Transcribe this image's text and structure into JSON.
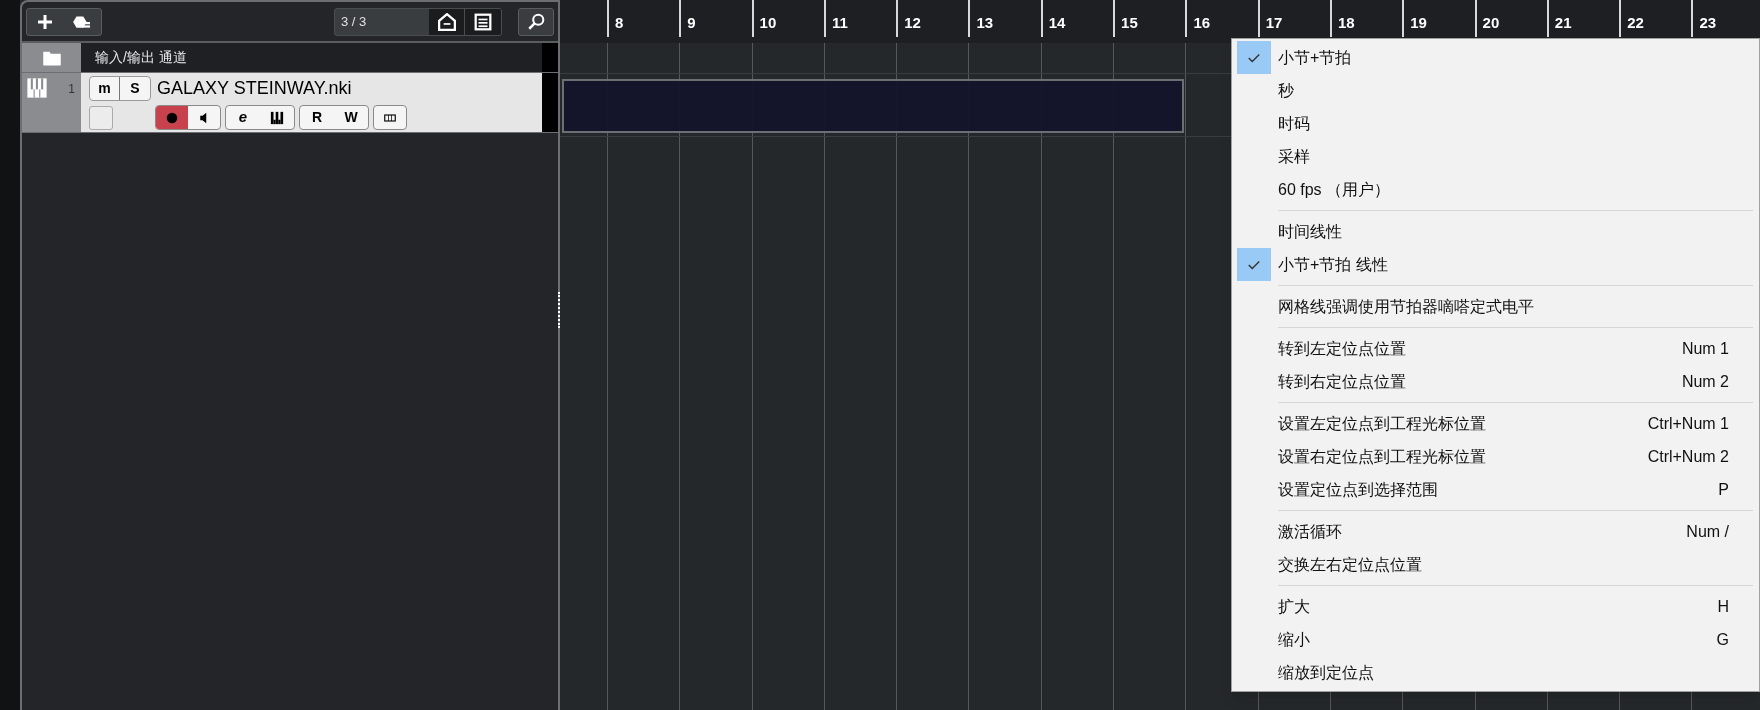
{
  "toolbar": {
    "track_counter": "3 / 3"
  },
  "track_list": {
    "header": {
      "title": "输入/输出 通道"
    },
    "tracks": [
      {
        "number": "1",
        "name": "GALAXY STEINWAY.nki",
        "mute_label": "m",
        "solo_label": "S",
        "record_enabled": true,
        "edit_label": "e",
        "read_label": "R",
        "write_label": "W"
      }
    ]
  },
  "ruler": {
    "bars": [
      "8",
      "9",
      "10",
      "11",
      "12",
      "13",
      "14",
      "15",
      "16",
      "17",
      "18",
      "19",
      "20",
      "21",
      "22",
      "23"
    ]
  },
  "context_menu": {
    "groups": [
      [
        {
          "label": "小节+节拍",
          "checked": true
        },
        {
          "label": "秒",
          "checked": false
        },
        {
          "label": "时码",
          "checked": false
        },
        {
          "label": "采样",
          "checked": false
        },
        {
          "label": "60 fps （用户）",
          "checked": false
        }
      ],
      [
        {
          "label": "时间线性",
          "checked": false
        },
        {
          "label": "小节+节拍 线性",
          "checked": true
        }
      ],
      [
        {
          "label": "网格线强调使用节拍器嘀嗒定式电平",
          "checked": false
        }
      ],
      [
        {
          "label": "转到左定位点位置",
          "shortcut": "Num 1",
          "checked": false
        },
        {
          "label": "转到右定位点位置",
          "shortcut": "Num 2",
          "checked": false
        }
      ],
      [
        {
          "label": "设置左定位点到工程光标位置",
          "shortcut": "Ctrl+Num 1",
          "checked": false
        },
        {
          "label": "设置右定位点到工程光标位置",
          "shortcut": "Ctrl+Num 2",
          "checked": false
        },
        {
          "label": "设置定位点到选择范围",
          "shortcut": "P",
          "checked": false
        }
      ],
      [
        {
          "label": "激活循环",
          "shortcut": "Num /",
          "checked": false
        },
        {
          "label": "交换左右定位点位置",
          "checked": false
        }
      ],
      [
        {
          "label": "扩大",
          "shortcut": "H",
          "checked": false
        },
        {
          "label": "缩小",
          "shortcut": "G",
          "checked": false
        },
        {
          "label": "缩放到定位点",
          "checked": false
        }
      ]
    ]
  }
}
